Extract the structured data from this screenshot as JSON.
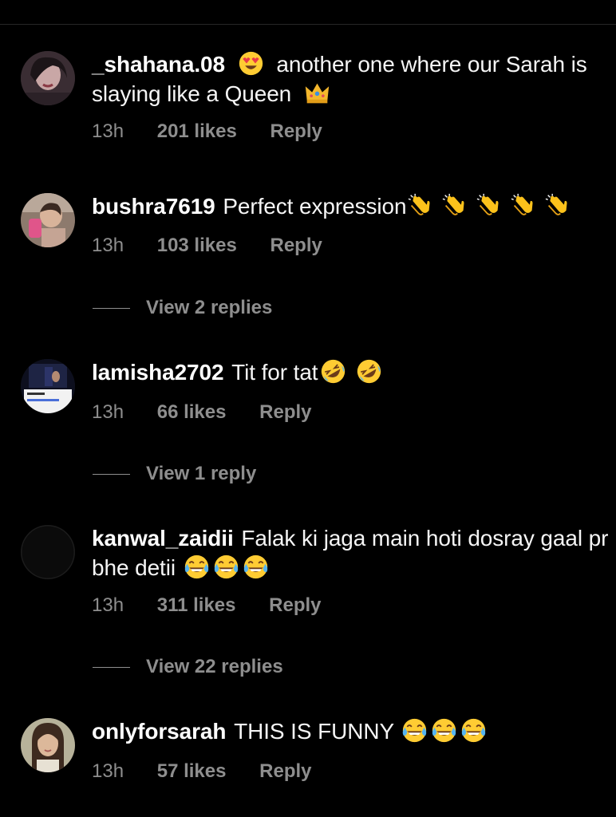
{
  "comments": [
    {
      "username": "_shahana.08",
      "text_lead_emoji": "smiling-face-heart-eyes",
      "text": "another one where our Sarah is slaying like a Queen",
      "trailing_emoji": [
        "crown"
      ],
      "time": "13h",
      "likes": "201 likes",
      "reply": "Reply"
    },
    {
      "username": "bushra7619",
      "text": "Perfect expression",
      "trailing_emoji": [
        "clapping-hands",
        "clapping-hands",
        "clapping-hands",
        "clapping-hands",
        "clapping-hands"
      ],
      "time": "13h",
      "likes": "103 likes",
      "reply": "Reply",
      "view_replies": "View 2 replies"
    },
    {
      "username": "lamisha2702",
      "text": "Tit for tat",
      "trailing_emoji": [
        "rolling-on-floor-laughing",
        "rolling-on-floor-laughing"
      ],
      "time": "13h",
      "likes": "66 likes",
      "reply": "Reply",
      "view_replies": "View 1 reply"
    },
    {
      "username": "kanwal_zaidii",
      "text": "Falak ki jaga main hoti dosray gaal pr bhe detii",
      "trailing_emoji": [
        "face-with-tears-of-joy",
        "face-with-tears-of-joy",
        "face-with-tears-of-joy"
      ],
      "time": "13h",
      "likes": "311 likes",
      "reply": "Reply",
      "view_replies": "View 22 replies"
    },
    {
      "username": "onlyforsarah",
      "text": "THIS IS FUNNY",
      "trailing_emoji": [
        "face-with-tears-of-joy",
        "face-with-tears-of-joy",
        "face-with-tears-of-joy"
      ],
      "time": "13h",
      "likes": "57 likes",
      "reply": "Reply"
    }
  ],
  "colors": {
    "background": "#000000",
    "text": "#f5f5f5",
    "muted": "#8e8e8e",
    "divider": "#262626"
  }
}
